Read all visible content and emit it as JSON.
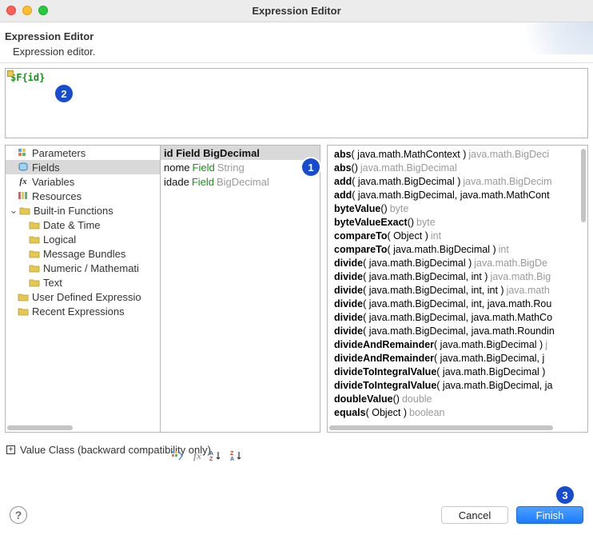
{
  "window_title": "Expression Editor",
  "header": {
    "title": "Expression Editor",
    "subtitle": "Expression editor."
  },
  "expression_text": "$F{id}",
  "tree": {
    "parameters": "Parameters",
    "fields": "Fields",
    "variables": "Variables",
    "resources": "Resources",
    "builtin": "Built-in Functions",
    "datetime": "Date & Time",
    "logical": "Logical",
    "msgbundles": "Message Bundles",
    "numeric": "Numeric / Mathemati",
    "text": "Text",
    "userdef": "User Defined Expressio",
    "recent": "Recent Expressions"
  },
  "fields_list": [
    {
      "name": "id",
      "kw": "Field",
      "type": "BigDecimal",
      "selected": true
    },
    {
      "name": "nome",
      "kw": "Field",
      "type": "String",
      "selected": false
    },
    {
      "name": "idade",
      "kw": "Field",
      "type": "BigDecimal",
      "selected": false
    }
  ],
  "methods": [
    {
      "name": "abs",
      "sig": "( java.math.MathContext )",
      "ret": "java.math.BigDeci"
    },
    {
      "name": "abs",
      "sig": "()",
      "ret": "java.math.BigDecimal"
    },
    {
      "name": "add",
      "sig": "( java.math.BigDecimal )",
      "ret": "java.math.BigDecim"
    },
    {
      "name": "add",
      "sig": "( java.math.BigDecimal, java.math.MathCont",
      "ret": ""
    },
    {
      "name": "byteValue",
      "sig": "()",
      "ret": "byte"
    },
    {
      "name": "byteValueExact",
      "sig": "()",
      "ret": "byte"
    },
    {
      "name": "compareTo",
      "sig": "( Object )",
      "ret": "int"
    },
    {
      "name": "compareTo",
      "sig": "( java.math.BigDecimal )",
      "ret": "int"
    },
    {
      "name": "divide",
      "sig": "( java.math.BigDecimal )",
      "ret": "java.math.BigDe"
    },
    {
      "name": "divide",
      "sig": "( java.math.BigDecimal, int )",
      "ret": "java.math.Big"
    },
    {
      "name": "divide",
      "sig": "( java.math.BigDecimal, int, int )",
      "ret": "java.math"
    },
    {
      "name": "divide",
      "sig": "( java.math.BigDecimal, int, java.math.Rou",
      "ret": ""
    },
    {
      "name": "divide",
      "sig": "( java.math.BigDecimal, java.math.MathCo",
      "ret": ""
    },
    {
      "name": "divide",
      "sig": "( java.math.BigDecimal, java.math.Roundin",
      "ret": ""
    },
    {
      "name": "divideAndRemainder",
      "sig": "( java.math.BigDecimal )",
      "ret": "j"
    },
    {
      "name": "divideAndRemainder",
      "sig": "( java.math.BigDecimal, j",
      "ret": ""
    },
    {
      "name": "divideToIntegralValue",
      "sig": "( java.math.BigDecimal )",
      "ret": ""
    },
    {
      "name": "divideToIntegralValue",
      "sig": "( java.math.BigDecimal, ja",
      "ret": ""
    },
    {
      "name": "doubleValue",
      "sig": "()",
      "ret": "double"
    },
    {
      "name": "equals",
      "sig": "( Object )",
      "ret": "boolean"
    }
  ],
  "value_class_label": "Value Class (backward compatibility only)",
  "buttons": {
    "cancel": "Cancel",
    "finish": "Finish"
  },
  "callouts": {
    "c1": "1",
    "c2": "2",
    "c3": "3"
  }
}
